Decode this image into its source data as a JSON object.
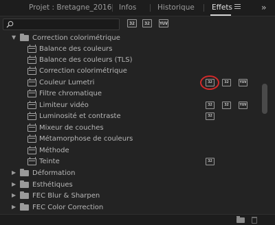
{
  "tabs": [
    {
      "label": "Projet : Bretagne_2016",
      "active": false
    },
    {
      "label": "Infos",
      "active": false
    },
    {
      "label": "Historique",
      "active": false
    },
    {
      "label": "Effets",
      "active": true
    }
  ],
  "search": {
    "value": "",
    "placeholder": ""
  },
  "filter_buttons": [
    "32",
    "32",
    "YUV"
  ],
  "tree": {
    "open_folder": "Correction colorimétrique",
    "effects": [
      {
        "label": "Balance des couleurs",
        "badges": []
      },
      {
        "label": "Balance des couleurs (TLS)",
        "badges": []
      },
      {
        "label": "Correction colorimétrique",
        "badges": []
      },
      {
        "label": "Couleur Lumetri",
        "badges": [
          "32",
          "32",
          "YUV"
        ],
        "highlighted_badge": "32"
      },
      {
        "label": "Filtre chromatique",
        "badges": []
      },
      {
        "label": "Limiteur vidéo",
        "badges": [
          "32",
          "32",
          "YUV"
        ]
      },
      {
        "label": "Luminosité et contraste",
        "badges": [
          "32"
        ]
      },
      {
        "label": "Mixeur de couches",
        "badges": []
      },
      {
        "label": "Métamorphose de couleurs",
        "badges": []
      },
      {
        "label": "Méthode",
        "badges": []
      },
      {
        "label": "Teinte",
        "badges": [
          "32"
        ]
      }
    ],
    "closed_folders": [
      "Déformation",
      "Esthétiques",
      "FEC Blur & Sharpen",
      "FEC Color Correction"
    ]
  },
  "colors": {
    "background": "#232323",
    "highlight_circle": "#d42a2a",
    "active_tab": "#e2e2e2"
  },
  "icons": {
    "menu": "hamburger-icon",
    "overflow": "double-chevron-right-icon",
    "search": "search-icon",
    "new_bin": "new-folder-icon",
    "delete": "trash-icon"
  }
}
